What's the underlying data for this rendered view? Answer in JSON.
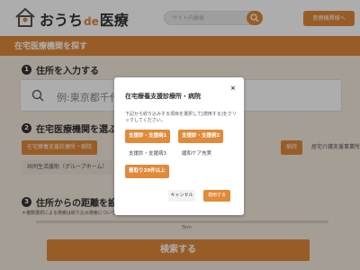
{
  "header": {
    "logo_prefix": "おうち",
    "logo_de": "de",
    "logo_suffix": "医療",
    "search_placeholder": "サイト内検索",
    "login_label": "医療機関様へ"
  },
  "page_title": "在宅医療機関を探す",
  "step1": {
    "number": "1",
    "label": "住所を入力する",
    "placeholder": "例:東京都千代田"
  },
  "step2": {
    "number": "2",
    "label": "在宅医療機関を選ぶ",
    "chips": [
      {
        "label": "在宅療養支援診療所・病院",
        "selected": true
      },
      {
        "label": "病院",
        "selected": true
      },
      {
        "label": "居宅介護支援事業所",
        "selected": false
      },
      {
        "label": "共同生活援助（グループホーム）",
        "selected": false
      }
    ],
    "note": "＊複数選択による検索は絞り込み検索について"
  },
  "step3": {
    "number": "3",
    "label": "住所からの距離を設定",
    "range_label": "5km"
  },
  "search_button": "検索する",
  "modal": {
    "title": "在宅療養支援診療所・病院",
    "close": "×",
    "description": "下記から絞り込みする項目を選択して[適用する]をクリックしてください。",
    "options": [
      {
        "label": "支援診・支援病1",
        "selected": true
      },
      {
        "label": "支援診・支援病2",
        "selected": true
      },
      {
        "label": "支援診・支援病3",
        "selected": false
      },
      {
        "label": "緩和ケア充実",
        "selected": false
      },
      {
        "label": "看取り20件以上",
        "selected": true
      }
    ],
    "cancel": "キャンセル",
    "apply": "適用する"
  },
  "colors": {
    "accent": "#e08a3a",
    "page_bg": "#f3e9dc"
  }
}
